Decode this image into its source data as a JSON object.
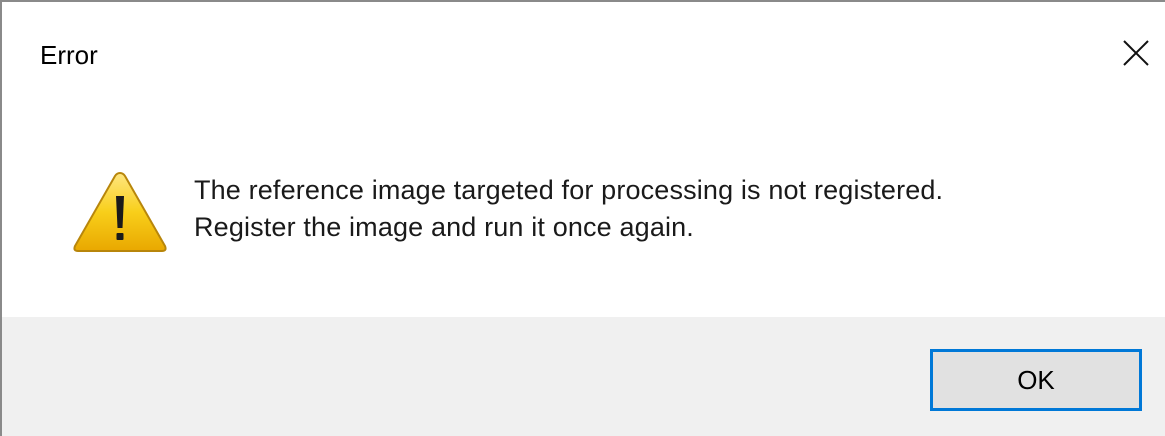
{
  "dialog": {
    "title": "Error",
    "close_icon": "close-icon",
    "icon": "warning-icon",
    "message_lines": [
      "The reference image targeted for processing is not registered.",
      "Register the image and run it once again."
    ],
    "ok_label": "OK"
  },
  "colors": {
    "footer_background": "#f0f0f0",
    "button_border_focus": "#0078d7",
    "button_background": "#e1e1e1",
    "warning_yellow": "#f5c400"
  }
}
